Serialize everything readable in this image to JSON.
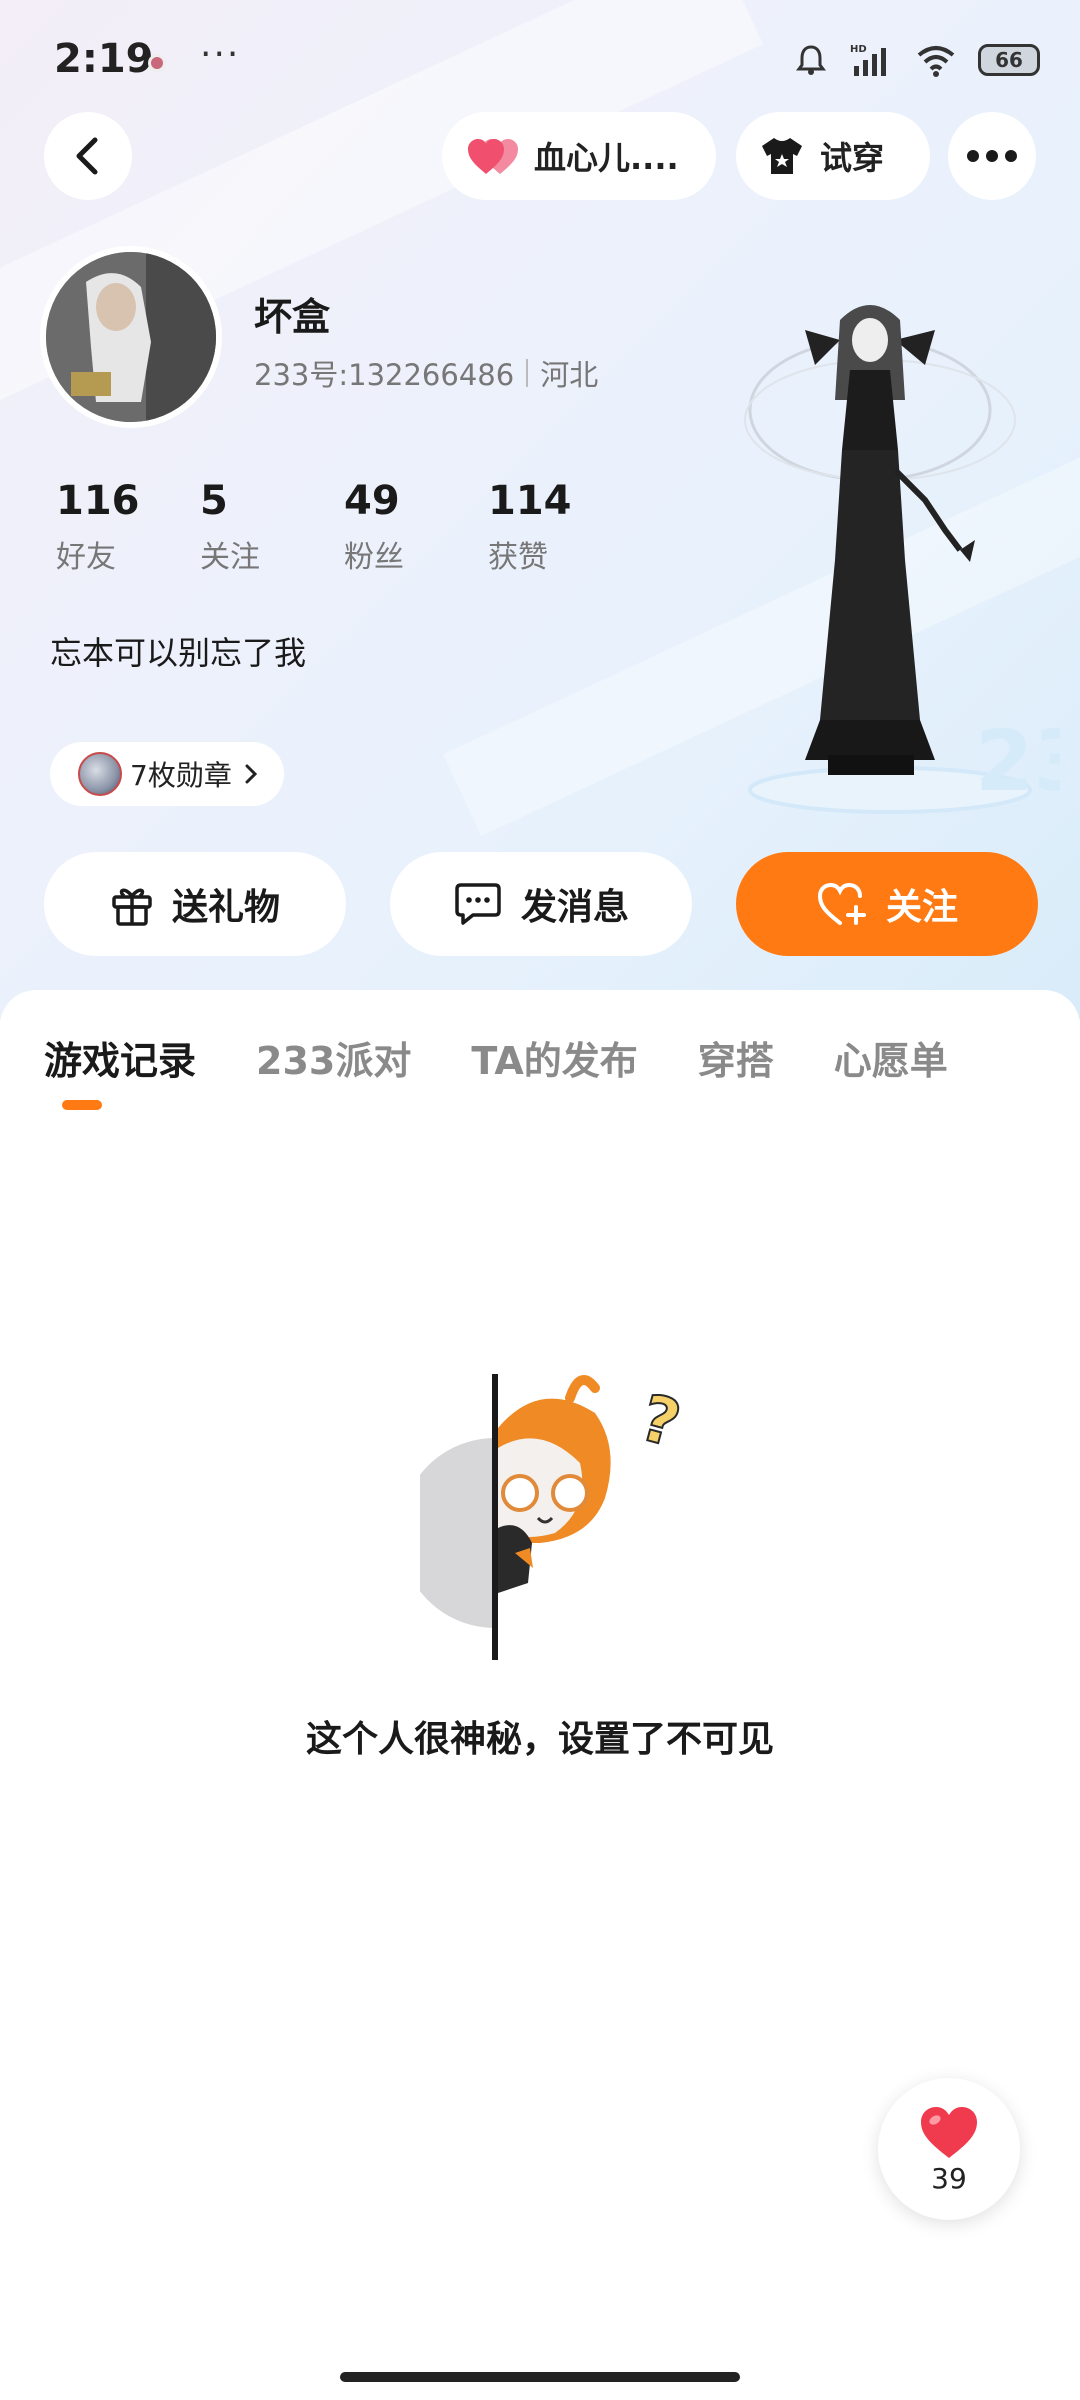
{
  "status_bar": {
    "time": "2:19",
    "more": "···",
    "battery": "66"
  },
  "top_nav": {
    "relation_label": "血心儿....",
    "try_on_label": "试穿"
  },
  "profile": {
    "nickname": "坏盒",
    "uid": "233号:132266486",
    "region": "河北",
    "bio": "忘本可以别忘了我",
    "badges_label": "7枚勋章"
  },
  "stats": [
    {
      "value": "116",
      "label": "好友"
    },
    {
      "value": "5",
      "label": "关注"
    },
    {
      "value": "49",
      "label": "粉丝"
    },
    {
      "value": "114",
      "label": "获赞"
    }
  ],
  "actions": {
    "gift": "送礼物",
    "message": "发消息",
    "follow": "关注"
  },
  "tabs": [
    {
      "label": "游戏记录",
      "active": true
    },
    {
      "label": "233派对",
      "active": false
    },
    {
      "label": "TA的发布",
      "active": false
    },
    {
      "label": "穿搭",
      "active": false
    },
    {
      "label": "心愿单",
      "active": false
    }
  ],
  "empty_state": {
    "text": "这个人很神秘，设置了不可见"
  },
  "like_fab": {
    "count": "39"
  },
  "colors": {
    "accent": "#ff7a12",
    "heart": "#f0506e"
  }
}
